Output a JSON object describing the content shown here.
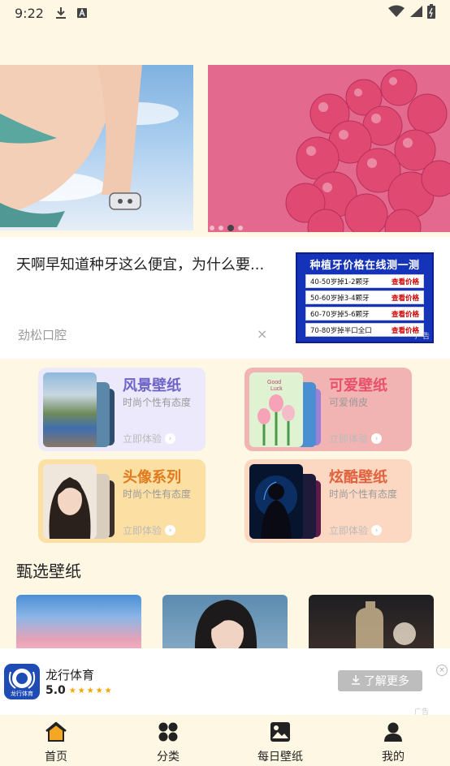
{
  "status": {
    "time": "9:22"
  },
  "ad": {
    "title": "天啊早知道种牙这么便宜，为什么要...",
    "source": "劲松口腔",
    "close": "×",
    "image": {
      "title": "种植牙价格在线测一测",
      "rows": [
        {
          "label": "40-50岁掉1-2颗牙",
          "action": "查看价格"
        },
        {
          "label": "50-60岁掉3-4颗牙",
          "action": "查看价格"
        },
        {
          "label": "60-70岁掉5-6颗牙",
          "action": "查看价格"
        },
        {
          "label": "70-80岁掉半口全口",
          "action": "查看价格"
        }
      ],
      "badge": "广告"
    }
  },
  "categories": [
    {
      "title": "风景壁纸",
      "sub": "时尚个性有态度",
      "cta": "立即体验"
    },
    {
      "title": "可爱壁纸",
      "sub": "可爱俏皮",
      "cta": "立即体验"
    },
    {
      "title": "头像系列",
      "sub": "时尚个性有态度",
      "cta": "立即体验"
    },
    {
      "title": "炫酷壁纸",
      "sub": "时尚个性有态度",
      "cta": "立即体验"
    }
  ],
  "selected": {
    "title": "甄选壁纸"
  },
  "bottom_ad": {
    "app_name": "龙行体育",
    "icon_text": "龙行体育",
    "rating": "5.0",
    "stars": "★★★★★",
    "button": "了解更多",
    "tag": "广告",
    "close": "×"
  },
  "nav": [
    {
      "label": "首页",
      "icon": "home-icon"
    },
    {
      "label": "分类",
      "icon": "category-icon"
    },
    {
      "label": "每日壁纸",
      "icon": "image-icon"
    },
    {
      "label": "我的",
      "icon": "profile-icon"
    }
  ],
  "colors": {
    "background": "#fdf7e4",
    "landscape_card": "#ebe9fb",
    "cute_card": "#f2b3b3",
    "avatar_card": "#fcdfa3",
    "cool_card": "#fcd8c2",
    "landscape_title": "#6e64c8",
    "cute_title": "#e8506a",
    "avatar_title": "#e07a1e",
    "cool_title": "#e0613d"
  }
}
